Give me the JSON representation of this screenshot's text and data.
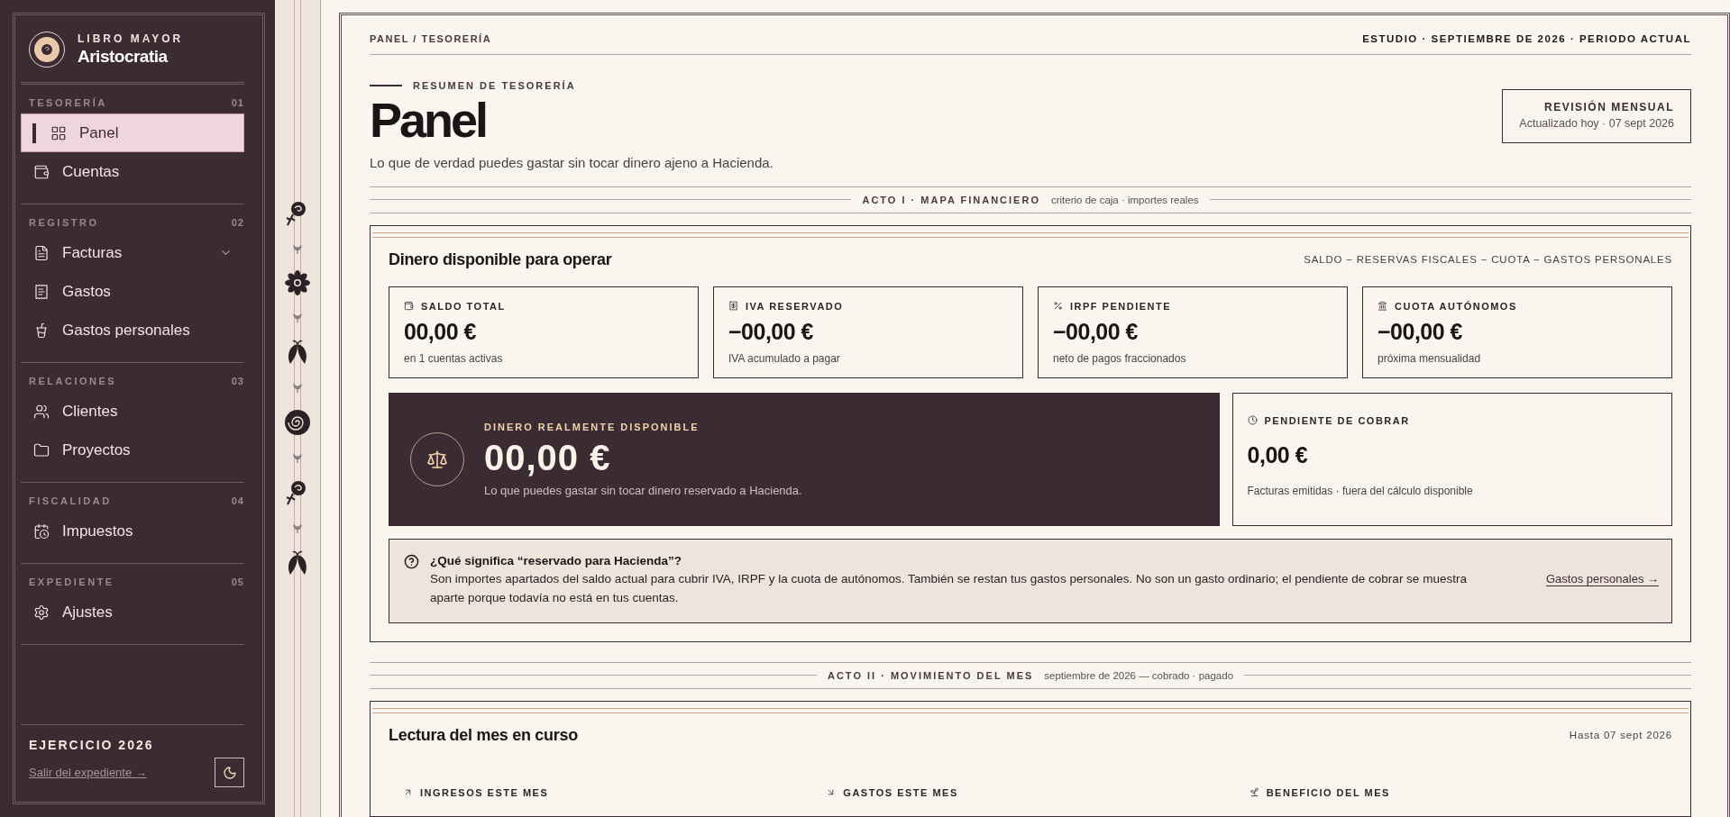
{
  "sidebar": {
    "eyebrow": "LIBRO MAYOR",
    "brand": "Aristocratia",
    "sections": [
      {
        "label": "TESORERÍA",
        "number": "01",
        "items": [
          {
            "label": "Panel",
            "kind": "link",
            "selected": true
          },
          {
            "label": "Cuentas",
            "kind": "link",
            "selected": false
          }
        ]
      },
      {
        "label": "REGISTRO",
        "number": "02",
        "items": [
          {
            "label": "Facturas",
            "kind": "group",
            "expanded": false,
            "selected": false
          },
          {
            "label": "Gastos",
            "kind": "link",
            "selected": false
          },
          {
            "label": "Gastos personales",
            "kind": "link",
            "selected": false
          }
        ]
      },
      {
        "label": "RELACIONES",
        "number": "03",
        "items": [
          {
            "label": "Clientes",
            "kind": "link",
            "selected": false
          },
          {
            "label": "Proyectos",
            "kind": "link",
            "selected": false
          }
        ]
      },
      {
        "label": "FISCALIDAD",
        "number": "04",
        "items": [
          {
            "label": "Impuestos",
            "kind": "link",
            "selected": false
          }
        ]
      },
      {
        "label": "EXPEDIENTE",
        "number": "05",
        "items": [
          {
            "label": "Ajustes",
            "kind": "link",
            "selected": false
          }
        ]
      }
    ],
    "footer": {
      "title": "EJERCICIO 2026",
      "link": "Salir del expediente →"
    }
  },
  "header": {
    "breadcrumb": "PANEL / TESORERÍA",
    "context": "ESTUDIO · SEPTIEMBRE DE 2026 · PERIODO ACTUAL",
    "eyebrow": "RESUMEN DE TESORERÍA",
    "title": "Panel",
    "subtitle": "Lo que de verdad puedes gastar sin tocar dinero ajeno a Hacienda.",
    "review": {
      "title": "REVISIÓN MENSUAL",
      "meta": "Actualizado hoy · 07 sept 2026"
    }
  },
  "act_1": {
    "label": "ACTO I · MAPA FINANCIERO",
    "note": "criterio de caja · importes reales"
  },
  "available_card": {
    "title": "Dinero disponible para operar",
    "formula": "SALDO − RESERVAS FISCALES − CUOTA − GASTOS PERSONALES",
    "stats": [
      {
        "label": "SALDO TOTAL",
        "value": "00,00 €",
        "caption": "en 1 cuentas activas"
      },
      {
        "label": "IVA RESERVADO",
        "value": "−00,00 €",
        "caption": "IVA acumulado a pagar"
      },
      {
        "label": "IRPF PENDIENTE",
        "value": "−00,00 €",
        "caption": "neto de pagos fraccionados"
      },
      {
        "label": "CUOTA AUTÓNOMOS",
        "value": "−00,00 €",
        "caption": "próxima mensualidad"
      }
    ],
    "highlight": {
      "label": "DINERO REALMENTE DISPONIBLE",
      "value": "00,00 €",
      "caption": "Lo que puedes gastar sin tocar dinero reservado a Hacienda."
    },
    "pending": {
      "label": "PENDIENTE DE COBRAR",
      "value": "0,00 €",
      "caption": "Facturas emitidas · fuera del cálculo disponible"
    },
    "info": {
      "question": "¿Qué significa “reservado para Hacienda”?",
      "text": "Son importes apartados del saldo actual para cubrir IVA, IRPF y la cuota de autónomos. También se restan tus gastos personales. No son un gasto ordinario; el pendiente de cobrar se muestra aparte porque todavía no está en tus cuentas.",
      "link": "Gastos personales →"
    }
  },
  "act_2": {
    "label": "ACTO II · MOVIMIENTO DEL MES",
    "note": "septiembre de 2026 — cobrado · pagado"
  },
  "month_card": {
    "title": "Lectura del mes en curso",
    "date": "Hasta 07 sept 2026",
    "stats": [
      {
        "label": "INGRESOS ESTE MES"
      },
      {
        "label": "GASTOS ESTE MES"
      },
      {
        "label": "BENEFICIO DEL MES"
      }
    ]
  }
}
